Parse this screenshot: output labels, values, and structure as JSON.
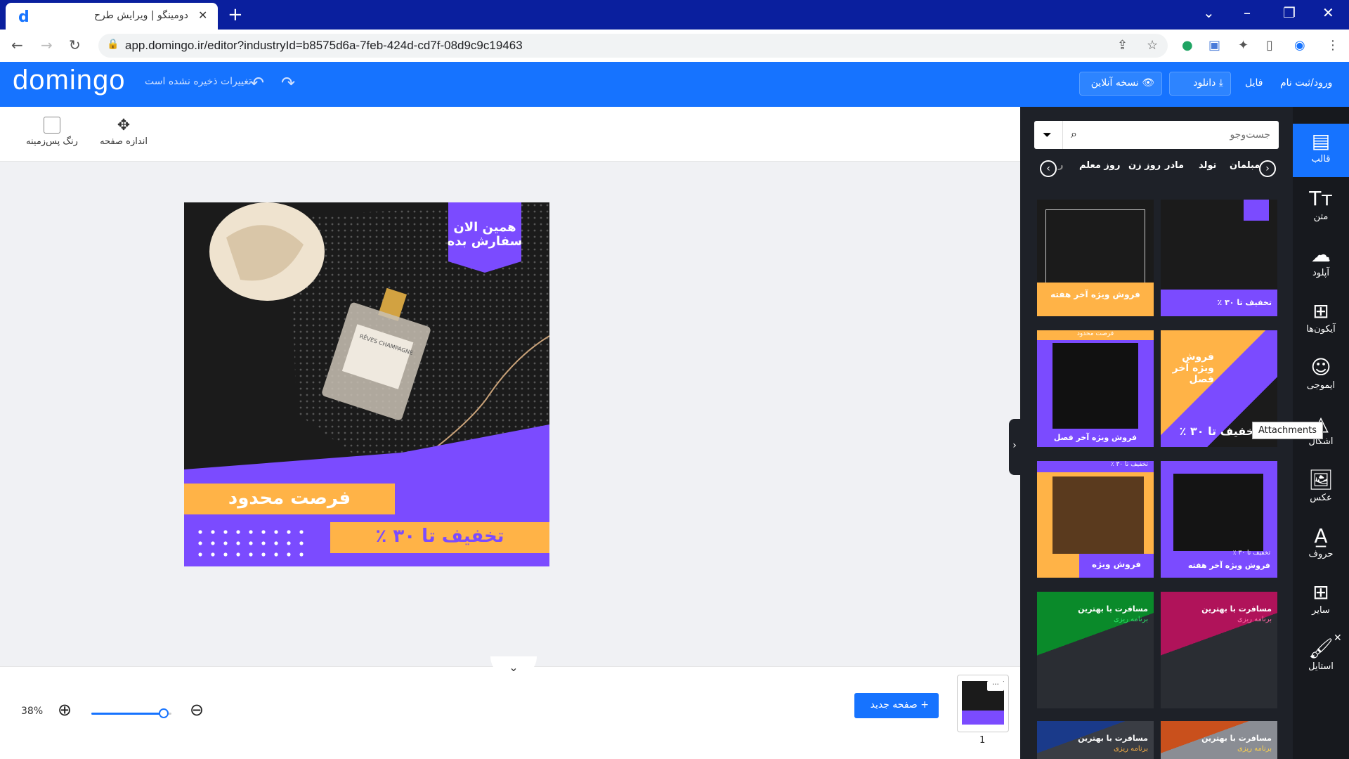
{
  "browser": {
    "tab_title": "دومینگو | ویرایش طرح",
    "favicon": "d",
    "url": "app.domingo.ir/editor?industryId=b8575d6a-7feb-424d-cd7f-08d9c9c19463"
  },
  "header": {
    "logo": "domingo",
    "unsaved": "تغییرات ذخیره نشده است",
    "login": "ورود/ثبت نام",
    "file": "فایل",
    "download": "دانلود",
    "preview": "نسخه آنلاین"
  },
  "toolbar": {
    "page_size": "اندازه صفحه",
    "bg_color": "رنگ پس‌زمینه"
  },
  "design": {
    "badge_line1": "همین الان",
    "badge_line2": "سفارش بده",
    "limited": "فرصت محدود",
    "discount": "تخفیف تا ۳۰ ٪",
    "bottle_text": "RÊVES CHAMPAGNE"
  },
  "bottom": {
    "zoom": "38%",
    "zoom_level": 0.9,
    "add_page": "صفحه جدید",
    "page_number": "1",
    "thumb_menu": "···"
  },
  "panel": {
    "search_placeholder": "جست‌وجو",
    "chips": [
      "مبلمان",
      "تولد",
      "مادر",
      "روز زن",
      "روز معلم"
    ],
    "chip_partial": "ر",
    "templates": [
      {
        "caption": "فروش ویژه آخر هفته"
      },
      {
        "caption": "تخفیف تا ۳۰ ٪"
      },
      {
        "caption": "فروش ویژه آخر فصل",
        "top": "فرصت محدود"
      },
      {
        "caption": "تخفیف تا ۳۰ ٪",
        "top": "فروش ویژه آخر فصل"
      },
      {
        "caption": "فروش ویژه",
        "top": "تخفیف تا ۳۰ ٪"
      },
      {
        "caption": "فروش ویژه آخر هفته",
        "top": "تخفیف تا ۳۰ ٪"
      },
      {
        "caption": "مسافرت با بهترین",
        "top": "برنامه ریزی"
      },
      {
        "caption": "مسافرت با بهترین",
        "top": "برنامه ریزی"
      },
      {
        "caption": "مسافرت با بهترین",
        "top": "برنامه ریزی"
      },
      {
        "caption": "مسافرت با بهترین",
        "top": "برنامه ریزی"
      }
    ]
  },
  "rail": [
    {
      "label": "قالب",
      "icon": "template-icon"
    },
    {
      "label": "متن",
      "icon": "text-icon"
    },
    {
      "label": "آپلود",
      "icon": "upload-icon"
    },
    {
      "label": "آیکون‌ها",
      "icon": "icons-icon"
    },
    {
      "label": "ایموجی",
      "icon": "emoji-icon"
    },
    {
      "label": "اشکال",
      "icon": "shapes-icon"
    },
    {
      "label": "عکس",
      "icon": "photo-icon"
    },
    {
      "label": "حروف",
      "icon": "letters-icon"
    },
    {
      "label": "سایر",
      "icon": "more-icon"
    },
    {
      "label": "استایل",
      "icon": "style-icon"
    }
  ],
  "tooltip": "Attachments",
  "colors": {
    "brand": "#1673ff",
    "purple": "#7b4bff",
    "orange": "#ffb347",
    "panel": "#1e2128"
  }
}
